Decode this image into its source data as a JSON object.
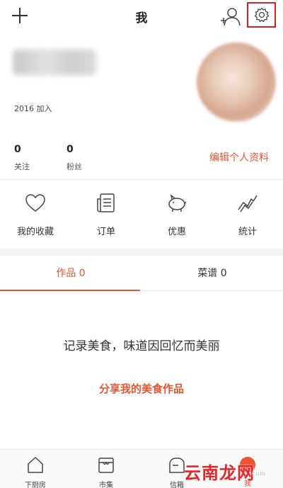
{
  "header": {
    "title": "我",
    "icons": [
      "plus-icon",
      "add-user-icon",
      "gear-icon"
    ]
  },
  "profile": {
    "name": "",
    "joined": "2016 加入",
    "stats": [
      {
        "value": "0",
        "label": "关注"
      },
      {
        "value": "0",
        "label": "粉丝"
      }
    ],
    "edit_label": "编辑个人资料"
  },
  "quick_actions": [
    {
      "label": "我的收藏",
      "icon": "heart-icon"
    },
    {
      "label": "订单",
      "icon": "order-list-icon"
    },
    {
      "label": "优惠",
      "icon": "piggy-bank-icon"
    },
    {
      "label": "统计",
      "icon": "trend-chart-icon"
    }
  ],
  "tabs": [
    {
      "label": "作品 0",
      "active": true
    },
    {
      "label": "菜谱 0",
      "active": false
    }
  ],
  "empty": {
    "message": "记录美食，味道因回忆而美丽",
    "action": "分享我的美食作品"
  },
  "bottom_nav": [
    {
      "label": "下厨房",
      "icon": "house-icon"
    },
    {
      "label": "市集",
      "icon": "market-icon"
    },
    {
      "label": "信箱",
      "icon": "mailbox-icon"
    },
    {
      "label": "我",
      "icon": "me-icon",
      "active": true
    }
  ],
  "watermark": {
    "text": "云南龙网",
    "sub": "com"
  },
  "colors": {
    "accent": "#e8552e",
    "highlight_box": "#e02020"
  }
}
